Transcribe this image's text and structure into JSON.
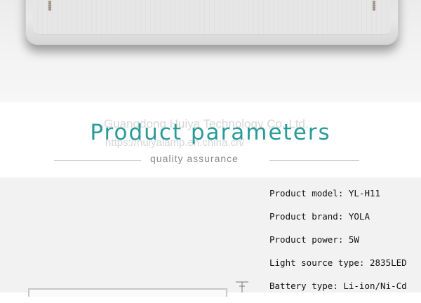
{
  "heading": {
    "title": "Product parameters",
    "subtitle": "quality  assurance",
    "watermark_company": "Guangdong Huiya Technology Co.,Ltd.",
    "watermark_url": "https://huiyalamp.en.china.cn/"
  },
  "parameters": [
    {
      "text": "Product model: YL-H11"
    },
    {
      "text": "Product brand: YOLA"
    },
    {
      "text": "Product power: 5W"
    },
    {
      "text": "Light source type: 2835LED"
    },
    {
      "text": "Battery type: Li-ion/Ni-Cd"
    }
  ],
  "colors": {
    "title": "#2a9a9a",
    "subtitle": "#8a8a8a",
    "params_background": "#f2f2f2"
  }
}
